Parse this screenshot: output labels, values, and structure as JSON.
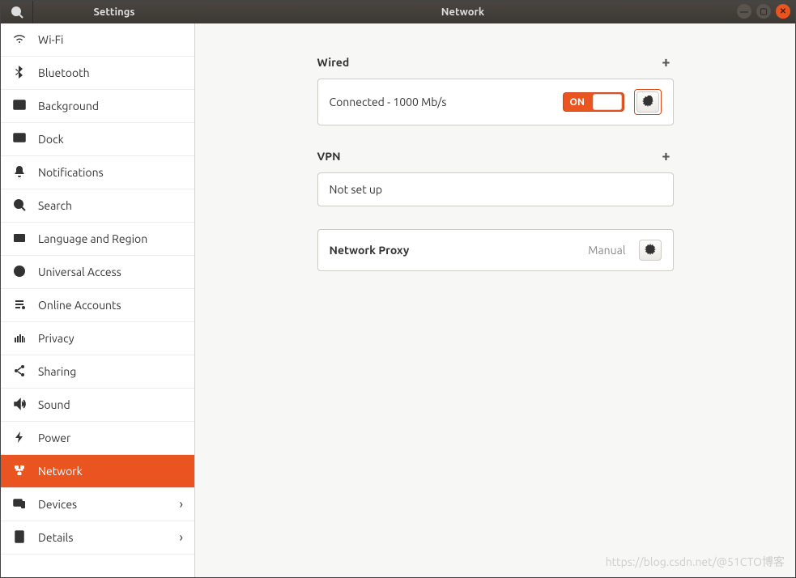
{
  "window": {
    "app_title": "Settings",
    "page_title": "Network"
  },
  "sidebar": {
    "items": [
      {
        "label": "Wi-Fi",
        "icon": "wifi-icon",
        "chevron": false
      },
      {
        "label": "Bluetooth",
        "icon": "bluetooth-icon",
        "chevron": false
      },
      {
        "label": "Background",
        "icon": "background-icon",
        "chevron": false
      },
      {
        "label": "Dock",
        "icon": "dock-icon",
        "chevron": false
      },
      {
        "label": "Notifications",
        "icon": "bell-icon",
        "chevron": false
      },
      {
        "label": "Search",
        "icon": "search-icon",
        "chevron": false
      },
      {
        "label": "Language and Region",
        "icon": "region-icon",
        "chevron": false
      },
      {
        "label": "Universal Access",
        "icon": "accessibility-icon",
        "chevron": false
      },
      {
        "label": "Online Accounts",
        "icon": "online-accounts-icon",
        "chevron": false
      },
      {
        "label": "Privacy",
        "icon": "privacy-icon",
        "chevron": false
      },
      {
        "label": "Sharing",
        "icon": "share-icon",
        "chevron": false
      },
      {
        "label": "Sound",
        "icon": "sound-icon",
        "chevron": false
      },
      {
        "label": "Power",
        "icon": "power-icon",
        "chevron": false
      },
      {
        "label": "Network",
        "icon": "network-icon",
        "chevron": false,
        "active": true
      },
      {
        "label": "Devices",
        "icon": "devices-icon",
        "chevron": true
      },
      {
        "label": "Details",
        "icon": "details-icon",
        "chevron": true
      }
    ]
  },
  "network": {
    "wired": {
      "header": "Wired",
      "status": "Connected - 1000 Mb/s",
      "toggle_label": "ON",
      "toggle_on": true
    },
    "vpn": {
      "header": "VPN",
      "status": "Not set up"
    },
    "proxy": {
      "title": "Network Proxy",
      "mode": "Manual"
    }
  },
  "watermark": "https://blog.csdn.net/@51CTO博客",
  "accent_color": "#e95420"
}
